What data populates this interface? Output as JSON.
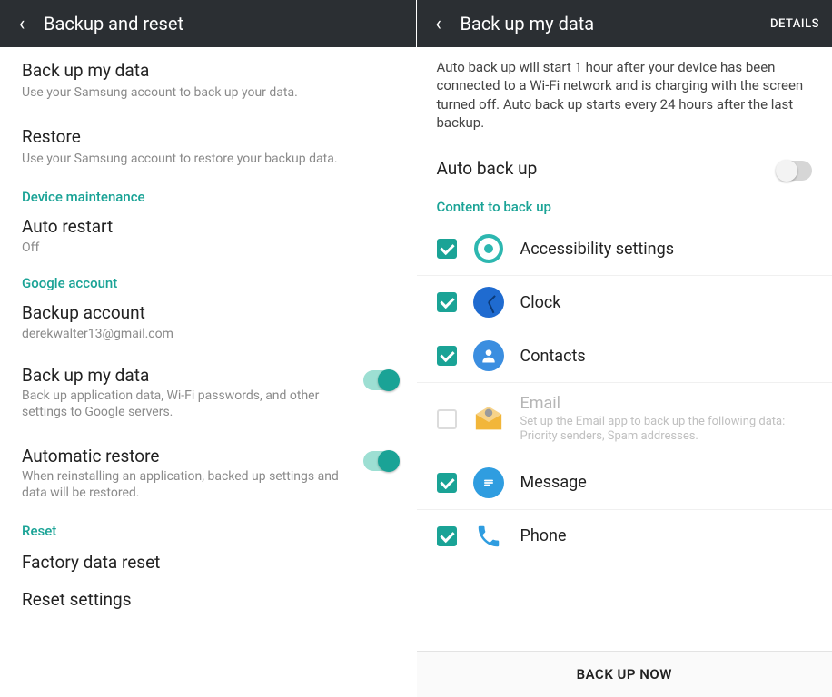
{
  "left": {
    "header": {
      "title": "Backup and reset"
    },
    "items": {
      "backupMyData": {
        "title": "Back up my data",
        "desc": "Use your Samsung account to back up your data."
      },
      "restore": {
        "title": "Restore",
        "desc": "Use your Samsung account to restore your backup data."
      }
    },
    "sectionDeviceMaintenance": "Device maintenance",
    "autoRestart": {
      "title": "Auto restart",
      "desc": "Off"
    },
    "sectionGoogle": "Google account",
    "backupAccount": {
      "title": "Backup account",
      "desc": "derekwalter13@gmail.com"
    },
    "backupMyDataGoogle": {
      "title": "Back up my data",
      "desc": "Back up application data, Wi-Fi passwords, and other settings to Google servers."
    },
    "automaticRestore": {
      "title": "Automatic restore",
      "desc": "When reinstalling an application, backed up settings and data will be restored."
    },
    "sectionReset": "Reset",
    "factoryReset": {
      "title": "Factory data reset"
    },
    "resetSettings": {
      "title": "Reset settings"
    }
  },
  "right": {
    "header": {
      "title": "Back up my data",
      "action": "DETAILS"
    },
    "info": "Auto back up will start 1 hour after your device has been connected to a Wi-Fi network and is charging with the screen turned off. Auto back up starts every 24 hours after the last backup.",
    "autoBackup": {
      "title": "Auto back up"
    },
    "sectionContent": "Content to back up",
    "contentItems": [
      {
        "label": "Accessibility settings"
      },
      {
        "label": "Clock"
      },
      {
        "label": "Contacts"
      },
      {
        "label": "Email",
        "desc": "Set up the Email app to back up the following data: Priority senders, Spam addresses."
      },
      {
        "label": "Message"
      },
      {
        "label": "Phone"
      }
    ],
    "bottomButton": "BACK UP NOW"
  }
}
